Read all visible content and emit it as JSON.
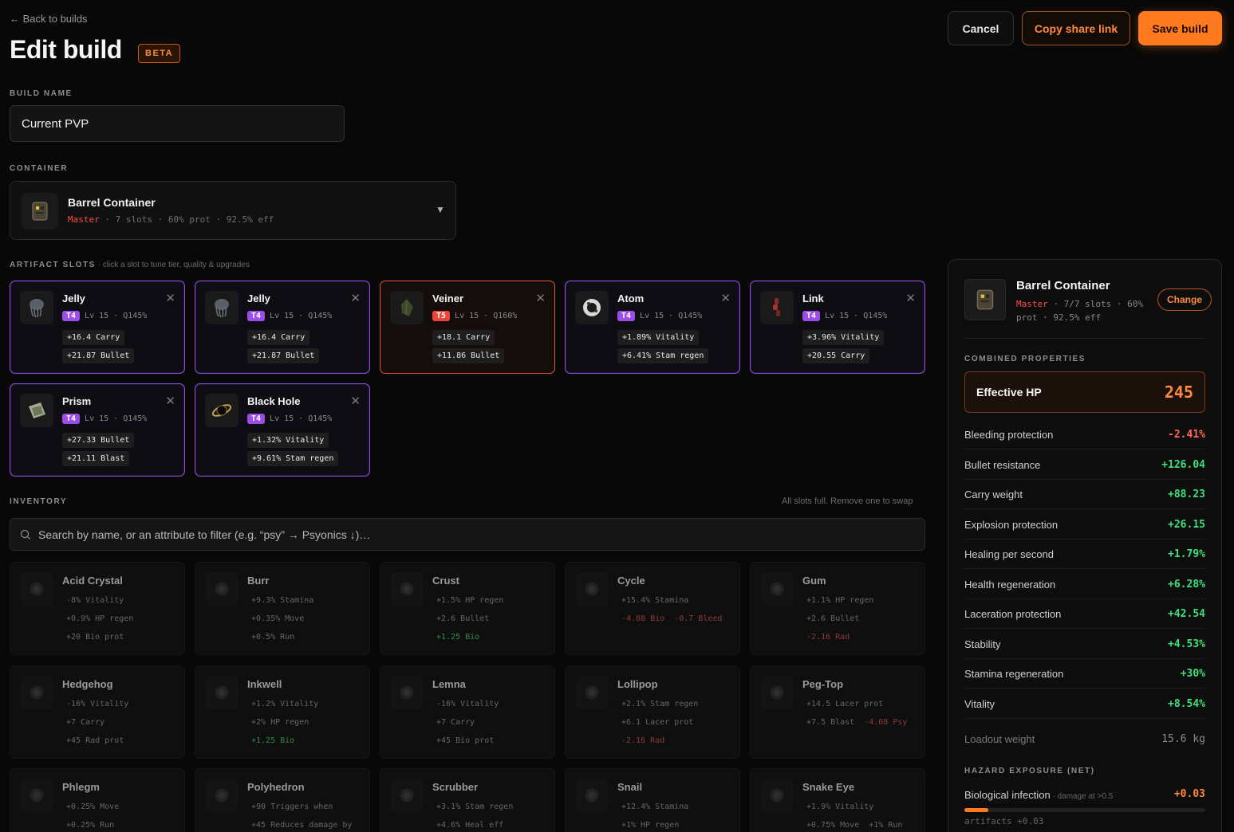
{
  "header": {
    "back_label": "← Back to builds",
    "title": "Edit build",
    "badge": "BETA",
    "cancel_label": "Cancel",
    "copy_label": "Copy share link",
    "save_label": "Save build"
  },
  "build_name": {
    "label": "BUILD NAME",
    "value": "Current PVP"
  },
  "container": {
    "label": "CONTAINER",
    "name": "Barrel Container",
    "rank": "Master",
    "details": " · 7 slots · 60% prot · 92.5% eff"
  },
  "slots_section": {
    "label": "ARTIFACT SLOTS",
    "hint": " · click a slot to tune tier, quality & upgrades"
  },
  "slots": [
    {
      "name": "Jelly",
      "tier": "T4",
      "meta": "Lv 15 · Q145%",
      "attrs": [
        "+16.4 Carry",
        "+21.87 Bullet"
      ],
      "icon": "jelly-icon"
    },
    {
      "name": "Jelly",
      "tier": "T4",
      "meta": "Lv 15 · Q145%",
      "attrs": [
        "+16.4 Carry",
        "+21.87 Bullet"
      ],
      "icon": "jelly-icon"
    },
    {
      "name": "Veiner",
      "tier": "T5",
      "meta": "Lv 15 · Q160%",
      "attrs": [
        "+18.1 Carry",
        "+11.86 Bullet"
      ],
      "icon": "veiner-icon"
    },
    {
      "name": "Atom",
      "tier": "T4",
      "meta": "Lv 15 · Q145%",
      "attrs": [
        "+1.89% Vitality",
        "+6.41% Stam regen"
      ],
      "icon": "atom-icon"
    },
    {
      "name": "Link",
      "tier": "T4",
      "meta": "Lv 15 · Q145%",
      "attrs": [
        "+3.96% Vitality",
        "+20.55 Carry"
      ],
      "icon": "link-icon"
    },
    {
      "name": "Prism",
      "tier": "T4",
      "meta": "Lv 15 · Q145%",
      "attrs": [
        "+27.33 Bullet",
        "+21.11 Blast"
      ],
      "icon": "prism-icon"
    },
    {
      "name": "Black Hole",
      "tier": "T4",
      "meta": "Lv 15 · Q145%",
      "attrs": [
        "+1.32% Vitality",
        "+9.61% Stam regen"
      ],
      "icon": "black-hole-icon"
    }
  ],
  "inventory": {
    "label": "INVENTORY",
    "status": "All slots full. Remove one to swap",
    "search_placeholder": "Search by name, or an attribute to filter (e.g. “psy” → Psyonics ↓)…",
    "items": [
      {
        "name": "Acid Crystal",
        "lines": [
          [
            "-8% Vitality"
          ],
          [
            "+0.9% HP regen"
          ],
          [
            "+20 Bio prot"
          ]
        ]
      },
      {
        "name": "Burr",
        "lines": [
          [
            "+9.3% Stamina"
          ],
          [
            "+0.35% Move"
          ],
          [
            "+0.5% Run"
          ]
        ]
      },
      {
        "name": "Crust",
        "lines": [
          [
            "+1.5% HP regen"
          ],
          [
            "+2.6 Bullet"
          ],
          [
            "+1.25 Bio"
          ]
        ]
      },
      {
        "name": "Cycle",
        "lines": [
          [
            "+15.4% Stamina"
          ],
          [
            "-4.08 Bio",
            "-0.7 Bleed"
          ]
        ]
      },
      {
        "name": "Gum",
        "lines": [
          [
            "+1.1% HP regen"
          ],
          [
            "+2.6 Bullet"
          ],
          [
            "-2.16 Rad"
          ]
        ]
      },
      {
        "name": "Hedgehog",
        "lines": [
          [
            "-16% Vitality"
          ],
          [
            "+7 Carry"
          ],
          [
            "+45 Rad prot"
          ]
        ]
      },
      {
        "name": "Inkwell",
        "lines": [
          [
            "+1.2% Vitality"
          ],
          [
            "+2% HP regen"
          ],
          [
            "+1.25 Bio"
          ]
        ]
      },
      {
        "name": "Lemna",
        "lines": [
          [
            "-16% Vitality"
          ],
          [
            "+7 Carry"
          ],
          [
            "+45 Bio prot"
          ]
        ]
      },
      {
        "name": "Lollipop",
        "lines": [
          [
            "+2.1% Stam regen"
          ],
          [
            "+6.1 Lacer prot"
          ],
          [
            "-2.16 Rad"
          ]
        ]
      },
      {
        "name": "Peg-Top",
        "lines": [
          [
            "+14.5 Lacer prot"
          ],
          [
            "+7.5 Blast",
            "-4.08 Psy"
          ]
        ]
      },
      {
        "name": "Phlegm",
        "lines": [
          [
            "+0.25% Move"
          ],
          [
            "+0.25% Run"
          ]
        ]
      },
      {
        "name": "Polyhedron",
        "lines": [
          [
            "+90 Triggers when"
          ],
          [
            "+45 Reduces damage by"
          ]
        ]
      },
      {
        "name": "Scrubber",
        "lines": [
          [
            "+3.1% Stam regen"
          ],
          [
            "+4.6% Heal eff"
          ]
        ]
      },
      {
        "name": "Snail",
        "lines": [
          [
            "+12.4% Stamina"
          ],
          [
            "+1% HP regen"
          ]
        ]
      },
      {
        "name": "Snake Eye",
        "lines": [
          [
            "+1.9% Vitality"
          ],
          [
            "+0.75% Move",
            "+1% Run"
          ]
        ]
      }
    ]
  },
  "panel": {
    "container_name": "Barrel Container",
    "rank": "Master",
    "meta1": " · 7/7 slots · 60%",
    "meta2": "prot · 92.5% eff",
    "change_label": "Change",
    "combined_label": "COMBINED PROPERTIES",
    "effective_hp_label": "Effective HP",
    "effective_hp_value": "245",
    "properties": [
      {
        "label": "Bleeding protection",
        "value": "-2.41%"
      },
      {
        "label": "Bullet resistance",
        "value": "+126.04"
      },
      {
        "label": "Carry weight",
        "value": "+88.23"
      },
      {
        "label": "Explosion protection",
        "value": "+26.15"
      },
      {
        "label": "Healing per second",
        "value": "+1.79%"
      },
      {
        "label": "Health regeneration",
        "value": "+6.28%"
      },
      {
        "label": "Laceration protection",
        "value": "+42.54"
      },
      {
        "label": "Stability",
        "value": "+4.53%"
      },
      {
        "label": "Stamina regeneration",
        "value": "+30%"
      },
      {
        "label": "Vitality",
        "value": "+8.54%"
      }
    ],
    "loadout_label": "Loadout weight",
    "loadout_value": "15.6 kg",
    "hazard_label": "HAZARD EXPOSURE (NET)",
    "hazard_name": "Biological infection",
    "hazard_hint": " · damage at >0.5",
    "hazard_value": "+0.03",
    "hazard_progress": 0.1,
    "hazard_sub": "artifacts +0.03"
  },
  "colors": {
    "accent": "#ff7a1f",
    "tier_t4": "#9b4de8",
    "tier_t5": "#e8473a",
    "positive": "#3ee07a",
    "negative": "#ff6b5a"
  }
}
